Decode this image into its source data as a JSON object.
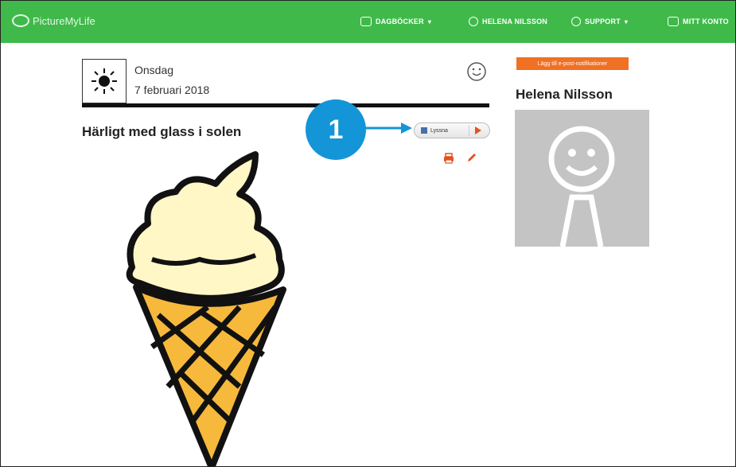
{
  "nav": {
    "brand": "PictureMyLife",
    "diaries": "DAGBÖCKER",
    "user": "HELENA NILSSON",
    "support": "SUPPORT",
    "account": "MITT KONTO"
  },
  "entry": {
    "weekday": "Onsdag",
    "date": "7 februari 2018",
    "title": "Härligt med glass i solen",
    "listen_label": "Lyssna"
  },
  "callout": {
    "number": "1"
  },
  "sidebar": {
    "notify_button": "Lägg till e-post-notifikationer",
    "owner_name": "Helena Nilsson"
  },
  "colors": {
    "nav_bg": "#3fba4a",
    "accent_orange": "#f07024",
    "callout_blue": "#1495d8"
  }
}
